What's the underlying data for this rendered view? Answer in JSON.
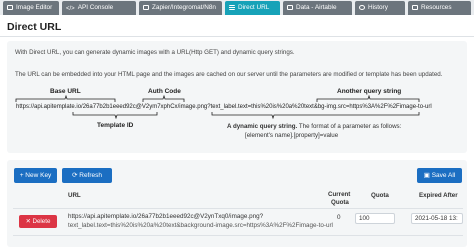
{
  "tabs": [
    {
      "label": "Image Editor",
      "icon": "image-icon"
    },
    {
      "label": "API Console",
      "icon": "code-icon"
    },
    {
      "label": "Zapier/Integromat/N8n",
      "icon": "plug-icon"
    },
    {
      "label": "Direct URL",
      "icon": "link-icon",
      "active": true
    },
    {
      "label": "Data - Airtable",
      "icon": "table-icon"
    },
    {
      "label": "History",
      "icon": "clock-icon"
    },
    {
      "label": "Resources",
      "icon": "book-icon"
    }
  ],
  "page": {
    "title": "Direct URL",
    "intro": "With Direct URL, you can generate dynamic images with a URL(Http GET) and dynamic query strings.",
    "intro2": "The URL can be embedded into your HTML page and the images are cached on our server until the parameters are modified or template has been updated."
  },
  "diagram": {
    "base_url_label": "Base URL",
    "auth_code_label": "Auth Code",
    "another_query_label": "Another query string",
    "template_id_label": "Template ID",
    "url_part1": "https://api.apitemplate.io/",
    "url_part2": "26a77b2b1eeed92c",
    "url_part3": "@V2ym7xphCx",
    "url_part4": "/image.png?",
    "url_part5": "text_label.text=this%20is%20a%20text",
    "url_part6": "&",
    "url_part7": "bg-img.src=https%3A%2F%2Fimage-to-url",
    "dynamic_bold": "A dynamic query string.",
    "dynamic_rest": " The format of a parameter as follows:",
    "dynamic_format": "[element's name].[property]=value"
  },
  "toolbar": {
    "new_key": "New Key",
    "refresh": "Refresh",
    "save_all": "Save All"
  },
  "table": {
    "headers": {
      "url": "URL",
      "current_quota_1": "Current",
      "current_quota_2": "Quota",
      "quota": "Quota",
      "expired_after": "Expired After"
    },
    "rows": [
      {
        "delete_label": "Delete",
        "url_line1": "https://api.apitemplate.io/26a77b2b1eeed92c@V2ynTxq0/image.png?",
        "url_line2": "text_label.text=this%20is%20a%20text&background-image.src=https%3A%2F%2Fimage-to-url",
        "current_quota": "0",
        "quota": "100",
        "expired_after": "2021-05-18 13:"
      }
    ]
  },
  "colors": {
    "tab_inactive": "#6c757d",
    "tab_active": "#17a2b8",
    "primary": "#1b6ec2",
    "danger": "#dc3545"
  }
}
